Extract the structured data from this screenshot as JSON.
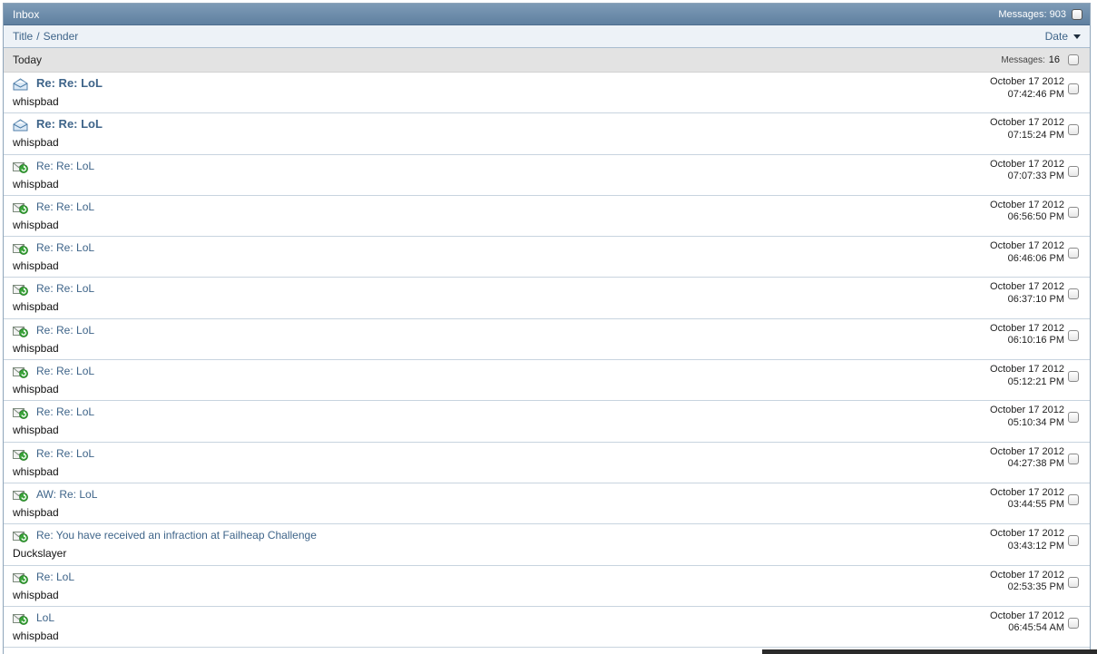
{
  "header": {
    "title": "Inbox",
    "messages_label": "Messages:",
    "messages_count": "903"
  },
  "columns": {
    "title_label": "Title",
    "separator": "/",
    "sender_label": "Sender",
    "date_label": "Date"
  },
  "group": {
    "label": "Today",
    "messages_label": "Messages:",
    "messages_count": "16"
  },
  "rows": [
    {
      "icon": "envelope-open-icon",
      "unread": true,
      "subject": "Re: Re: LoL",
      "sender": "whispbad",
      "date": "October 17 2012",
      "time": "07:42:46 PM"
    },
    {
      "icon": "envelope-open-icon",
      "unread": true,
      "subject": "Re: Re: LoL",
      "sender": "whispbad",
      "date": "October 17 2012",
      "time": "07:15:24 PM"
    },
    {
      "icon": "envelope-replied-icon",
      "unread": false,
      "subject": "Re: Re: LoL",
      "sender": "whispbad",
      "date": "October 17 2012",
      "time": "07:07:33 PM"
    },
    {
      "icon": "envelope-replied-icon",
      "unread": false,
      "subject": "Re: Re: LoL",
      "sender": "whispbad",
      "date": "October 17 2012",
      "time": "06:56:50 PM"
    },
    {
      "icon": "envelope-replied-icon",
      "unread": false,
      "subject": "Re: Re: LoL",
      "sender": "whispbad",
      "date": "October 17 2012",
      "time": "06:46:06 PM"
    },
    {
      "icon": "envelope-replied-icon",
      "unread": false,
      "subject": "Re: Re: LoL",
      "sender": "whispbad",
      "date": "October 17 2012",
      "time": "06:37:10 PM"
    },
    {
      "icon": "envelope-replied-icon",
      "unread": false,
      "subject": "Re: Re: LoL",
      "sender": "whispbad",
      "date": "October 17 2012",
      "time": "06:10:16 PM"
    },
    {
      "icon": "envelope-replied-icon",
      "unread": false,
      "subject": "Re: Re: LoL",
      "sender": "whispbad",
      "date": "October 17 2012",
      "time": "05:12:21 PM"
    },
    {
      "icon": "envelope-replied-icon",
      "unread": false,
      "subject": "Re: Re: LoL",
      "sender": "whispbad",
      "date": "October 17 2012",
      "time": "05:10:34 PM"
    },
    {
      "icon": "envelope-replied-icon",
      "unread": false,
      "subject": "Re: Re: LoL",
      "sender": "whispbad",
      "date": "October 17 2012",
      "time": "04:27:38 PM"
    },
    {
      "icon": "envelope-replied-icon",
      "unread": false,
      "subject": "AW: Re: LoL",
      "sender": "whispbad",
      "date": "October 17 2012",
      "time": "03:44:55 PM"
    },
    {
      "icon": "envelope-replied-icon",
      "unread": false,
      "subject": "Re: You have received an infraction at Failheap Challenge",
      "sender": "Duckslayer",
      "date": "October 17 2012",
      "time": "03:43:12 PM"
    },
    {
      "icon": "envelope-replied-icon",
      "unread": false,
      "subject": "Re: LoL",
      "sender": "whispbad",
      "date": "October 17 2012",
      "time": "02:53:35 PM"
    },
    {
      "icon": "envelope-replied-icon",
      "unread": false,
      "subject": "LoL",
      "sender": "whispbad",
      "date": "October 17 2012",
      "time": "06:45:54 AM"
    }
  ],
  "colors": {
    "link": "#3e6489",
    "titlebar": "#6f8eac",
    "group_bg": "#e3e3e3",
    "replied_icon_green": "#2f9b2f"
  }
}
